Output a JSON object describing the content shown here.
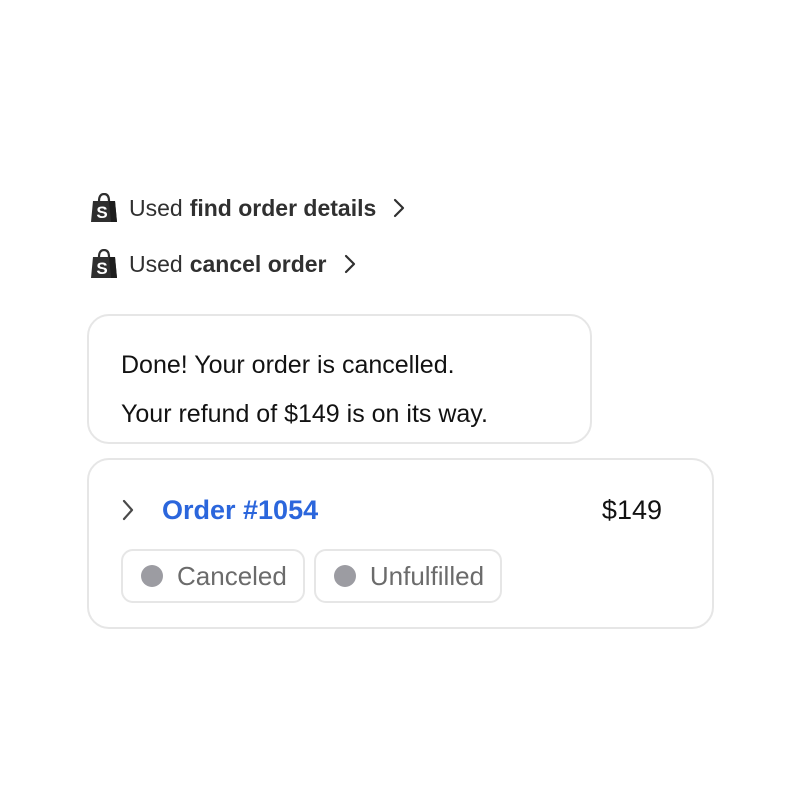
{
  "tool_calls": [
    {
      "prefix": "Used",
      "name": "find order details",
      "icon": "shopify-bag-icon"
    },
    {
      "prefix": "Used",
      "name": "cancel order",
      "icon": "shopify-bag-icon"
    }
  ],
  "message": {
    "lines": [
      "Done! Your order is cancelled.",
      "Your refund of $149 is on its way."
    ]
  },
  "order": {
    "title": "Order #1054",
    "amount": "$149",
    "link_color": "#2b66dc",
    "statuses": [
      {
        "label": "Canceled",
        "dot_color": "#9c9ca2"
      },
      {
        "label": "Unfulfilled",
        "dot_color": "#9c9ca2"
      }
    ]
  }
}
